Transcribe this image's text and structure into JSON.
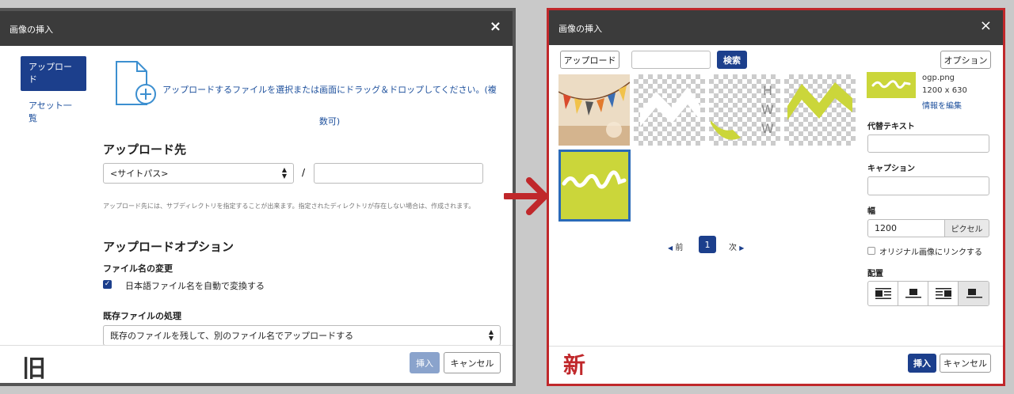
{
  "old_dialog": {
    "title": "画像の挿入",
    "close_icon": "×",
    "sidebar": {
      "upload_tab": "アップロード",
      "asset_tab": "アセット一覧"
    },
    "drop_text": "アップロードするファイルを選択または画面にドラッグ＆ドロップしてください。(複数可)",
    "upload_dest": {
      "heading": "アップロード先",
      "select_value": "<サイトパス>",
      "separator": "/",
      "path_value": "",
      "help": "アップロード先には、サブディレクトリを指定することが出来ます。指定されたディレクトリが存在しない場合は、作成されます。"
    },
    "options": {
      "heading": "アップロードオプション",
      "rename_label": "ファイル名の変更",
      "auto_convert_label": "日本語ファイル名を自動で変換する",
      "auto_convert_checked": true,
      "existing_label": "既存ファイルの処理",
      "existing_value": "既存のファイルを残して、別のファイル名でアップロードする"
    },
    "footer": {
      "insert_label": "挿入",
      "cancel_label": "キャンセル"
    },
    "tag": "旧"
  },
  "new_dialog": {
    "title": "画像の挿入",
    "close_icon": "×",
    "toolbar": {
      "upload_label": "アップロード",
      "search_value": "",
      "search_label": "検索",
      "options_label": "オプション"
    },
    "thumbnails": [
      {
        "name": "bunting-photo"
      },
      {
        "name": "white-logo-transparent"
      },
      {
        "name": "hww-text-transparent"
      },
      {
        "name": "yellow-wave-transparent"
      },
      {
        "name": "ogp-yellow",
        "selected": true
      }
    ],
    "pagination": {
      "prev_label": "前",
      "current": "1",
      "next_label": "次"
    },
    "details": {
      "filename": "ogp.png",
      "dimensions": "1200 x 630",
      "edit_link": "情報を編集",
      "alt_label": "代替テキスト",
      "alt_value": "",
      "caption_label": "キャプション",
      "caption_value": "",
      "width_label": "幅",
      "width_value": "1200",
      "width_unit": "ピクセル",
      "link_original_label": "オリジナル画像にリンクする",
      "link_original_checked": false,
      "align_label": "配置",
      "align_options": [
        "left",
        "center",
        "right",
        "none"
      ],
      "align_selected": "none"
    },
    "footer": {
      "insert_label": "挿入",
      "cancel_label": "キャンセル"
    },
    "tag": "新"
  },
  "colors": {
    "primary": "#1c3f8c",
    "lime": "#cbd63a",
    "red_accent": "#c0282b",
    "link_blue": "#1c4f9c"
  }
}
